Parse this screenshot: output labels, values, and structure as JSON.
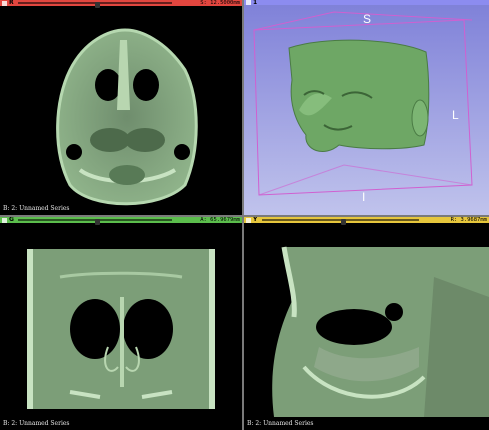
{
  "views": {
    "red": {
      "letter": "R",
      "offset": "S: 12.5000mm",
      "series": "B: 2: Unnamed Series",
      "color": "#e2463f",
      "slider_fraction": 0.5
    },
    "three_d": {
      "letter": "1",
      "color": "#8c8cf0"
    },
    "green": {
      "letter": "G",
      "offset": "A: 65.9679mm",
      "series": "B: 2: Unnamed Series",
      "color": "#5bbd4c",
      "slider_fraction": 0.5
    },
    "yellow": {
      "letter": "Y",
      "offset": "R: 3.9687mm",
      "series": "B: 2: Unnamed Series",
      "color": "#e6c63c",
      "slider_fraction": 0.5
    }
  },
  "orientation": {
    "superior": "S",
    "left": "L",
    "inferior": "I"
  }
}
